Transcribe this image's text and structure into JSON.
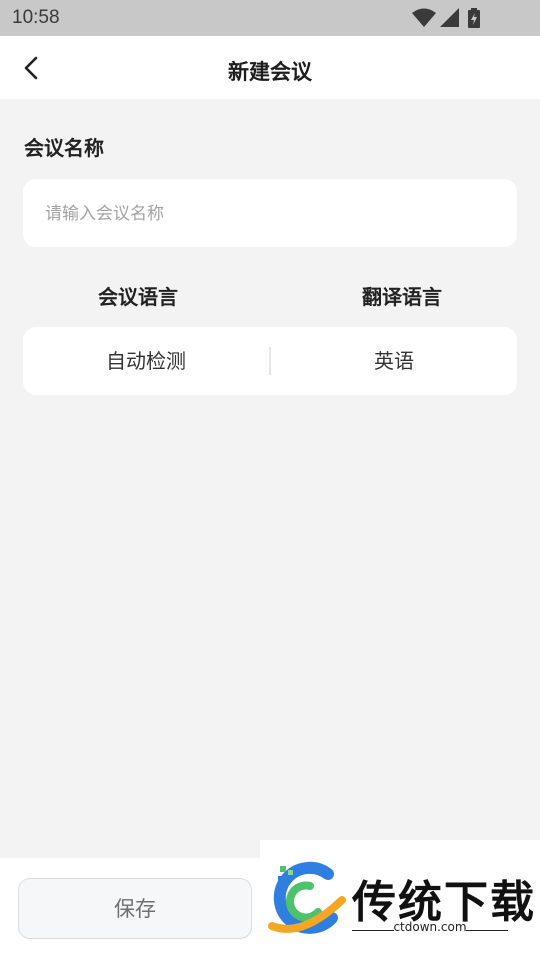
{
  "status_bar": {
    "time": "10:58",
    "icons": [
      "wifi-icon",
      "signal-icon",
      "battery-charging-icon"
    ]
  },
  "header": {
    "title": "新建会议",
    "back_icon": "chevron-left-icon"
  },
  "meeting_name": {
    "label": "会议名称",
    "value": "",
    "placeholder": "请输入会议名称"
  },
  "languages": {
    "meeting_language_label": "会议语言",
    "translation_language_label": "翻译语言",
    "meeting_language_value": "自动检测",
    "translation_language_value": "英语"
  },
  "footer": {
    "save_label": "保存"
  },
  "watermark": {
    "brand": "传统下载",
    "url": "ctdown.com"
  },
  "colors": {
    "background": "#f3f3f3",
    "card": "#ffffff",
    "status_bar": "#c8c8c8",
    "logo_blue": "#2f7fe0",
    "logo_green": "#4cc36a",
    "logo_orange": "#f5a623"
  }
}
